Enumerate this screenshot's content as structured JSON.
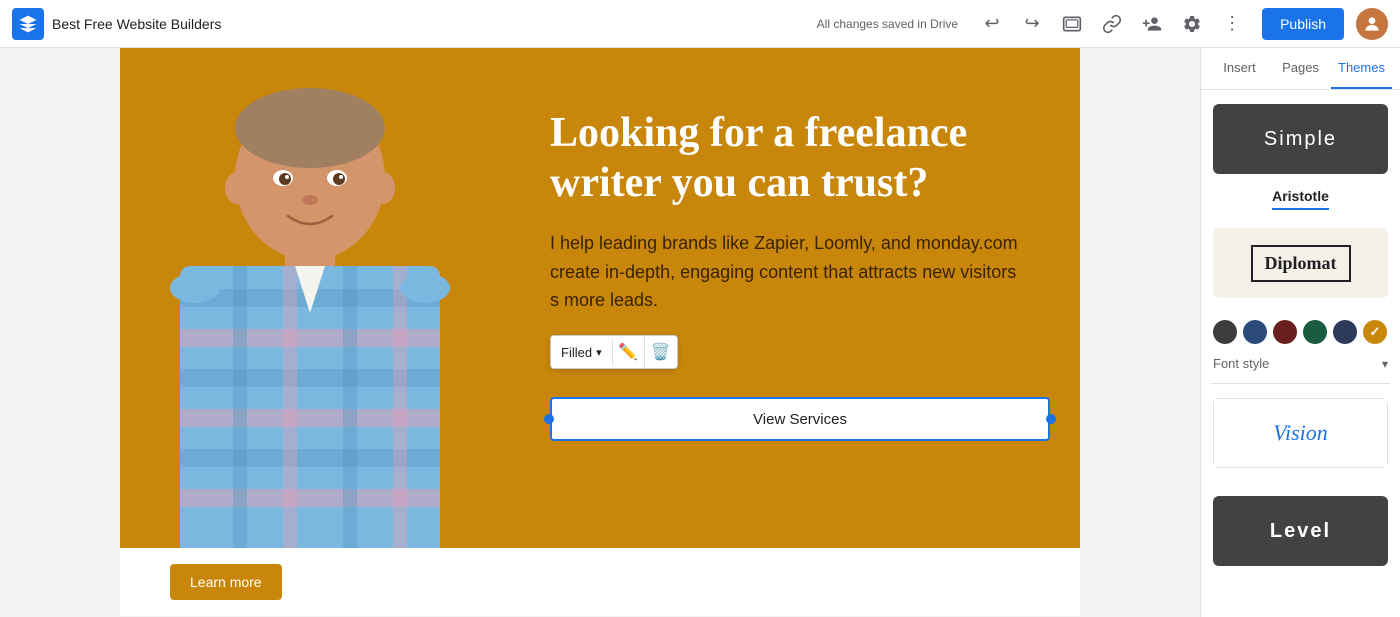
{
  "topbar": {
    "logo_icon": "G",
    "title": "Best Free Website Builders",
    "status": "All changes saved in Drive",
    "publish_label": "Publish",
    "avatar_label": "U"
  },
  "hero": {
    "heading": "Looking for a freelance writer you can trust?",
    "subtext": "I help leading brands like Zapier, Loomly, and monday.com create in-depth, engaging content that attracts new visitors",
    "subtext2": "s more leads.",
    "background_color": "#c8870a",
    "button_label": "View Services",
    "button_style": "Filled"
  },
  "bottom": {
    "learn_more_label": "Learn more"
  },
  "right_panel": {
    "tabs": [
      {
        "label": "Insert",
        "active": false
      },
      {
        "label": "Pages",
        "active": false
      },
      {
        "label": "Themes",
        "active": true
      }
    ],
    "themes": [
      {
        "name": "simple",
        "label": "Simple"
      },
      {
        "name": "aristotle",
        "label": "Aristotle",
        "selected": true
      },
      {
        "name": "diplomat",
        "label": "Diplomat"
      },
      {
        "name": "vision",
        "label": "Vision"
      },
      {
        "name": "level",
        "label": "Level"
      }
    ],
    "swatches": [
      {
        "color": "#3c3c3c",
        "selected": false
      },
      {
        "color": "#2c4a7a",
        "selected": false
      },
      {
        "color": "#6b2020",
        "selected": false
      },
      {
        "color": "#1a5c40",
        "selected": false
      },
      {
        "color": "#2c3a5a",
        "selected": false
      },
      {
        "color": "#c8870a",
        "selected": true
      }
    ],
    "font_style_label": "Font style",
    "font_style_value": ""
  }
}
